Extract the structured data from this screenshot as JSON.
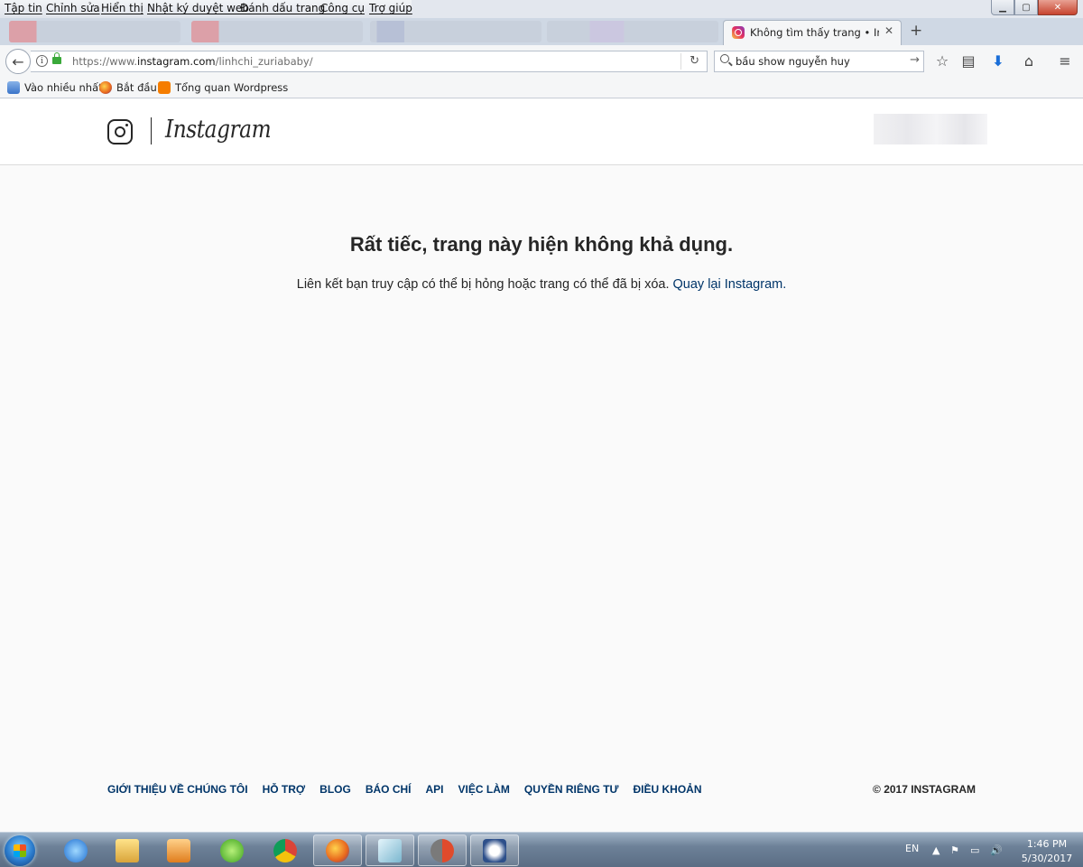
{
  "menu": [
    "Tập tin",
    "Chỉnh sửa",
    "Hiển thị",
    "Nhật ký duyệt web",
    "Đánh dấu trang",
    "Công cụ",
    "Trợ giúp"
  ],
  "tab": {
    "title": "Không tìm thấy trang • Instag",
    "close_glyph": "✕",
    "new_tab_glyph": "+"
  },
  "address": {
    "prefix": "https://www.",
    "domain": "instagram.com",
    "path": "/linhchi_zuriababy/"
  },
  "search": {
    "query": "bầu show nguyễn huy"
  },
  "bookmarks": [
    "Vào nhiều nhất",
    "Bắt đầu",
    "Tổng quan Wordpress"
  ],
  "page": {
    "brand": "Instagram",
    "error_title": "Rất tiếc, trang này hiện không khả dụng.",
    "error_message": "Liên kết bạn truy cập có thể bị hỏng hoặc trang có thể đã bị xóa.",
    "error_link": "Quay lại Instagram."
  },
  "footer": {
    "links": [
      "GIỚI THIỆU VỀ CHÚNG TÔI",
      "HỖ TRỢ",
      "BLOG",
      "BÁO CHÍ",
      "API",
      "VIỆC LÀM",
      "QUYỀN RIÊNG TƯ",
      "ĐIỀU KHOẢN"
    ],
    "copyright": "© 2017 INSTAGRAM"
  },
  "taskbar": {
    "lang": "EN",
    "time": "1:46 PM",
    "date": "5/30/2017"
  },
  "icons": {
    "back": "back-arrow-icon",
    "info": "info-icon",
    "lock": "lock-icon",
    "reload": "reload-icon",
    "search": "search-icon",
    "go": "go-arrow-icon",
    "bookmark_star": "star-icon",
    "reader": "reader-icon",
    "download": "download-icon",
    "home": "home-icon",
    "menu": "hamburger-icon"
  },
  "colors": {
    "link": "#003569",
    "text": "#262626",
    "page_bg": "#fafafa",
    "lock": "#3aa93a"
  }
}
